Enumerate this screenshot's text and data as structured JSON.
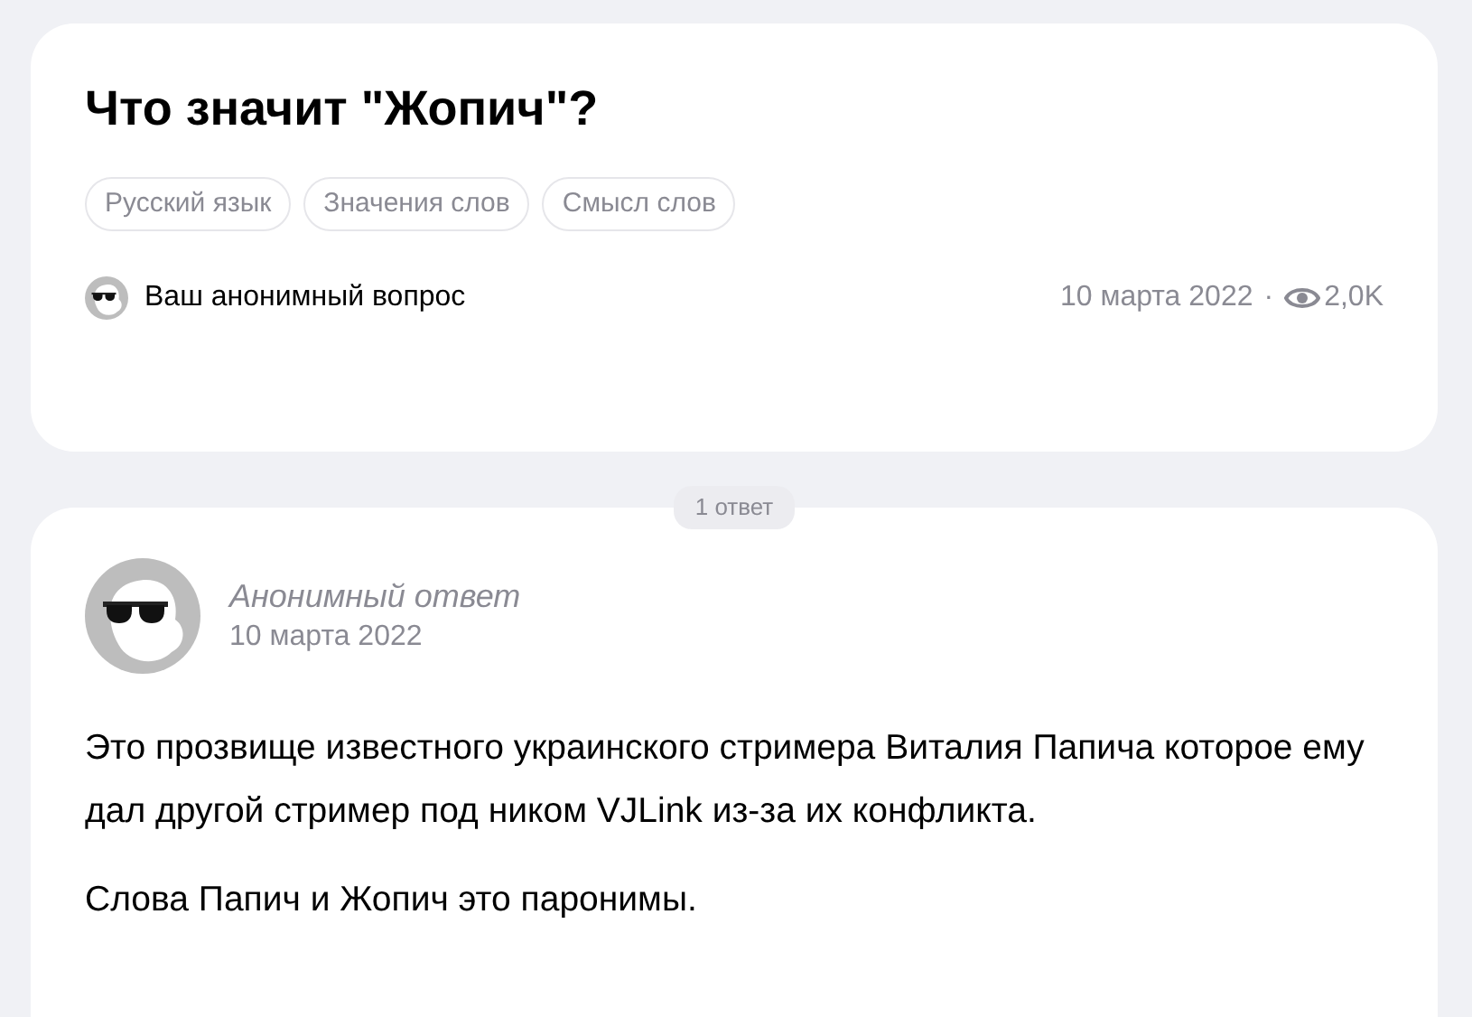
{
  "question": {
    "title": "Что значит \"Жопич\"?",
    "tags": [
      "Русский язык",
      "Значения слов",
      "Смысл слов"
    ],
    "author": "Ваш анонимный вопрос",
    "date": "10 марта 2022",
    "separator": "·",
    "views": "2,0K"
  },
  "answers_count": "1 ответ",
  "answers": [
    {
      "author": "Анонимный ответ",
      "date": "10 марта 2022",
      "paragraphs": [
        "Это прозвище известного украинского стримера Виталия Папича которое ему дал другой стример под ником VJLink из-за их конфликта.",
        "Слова Папич и Жопич это паронимы."
      ]
    }
  ]
}
